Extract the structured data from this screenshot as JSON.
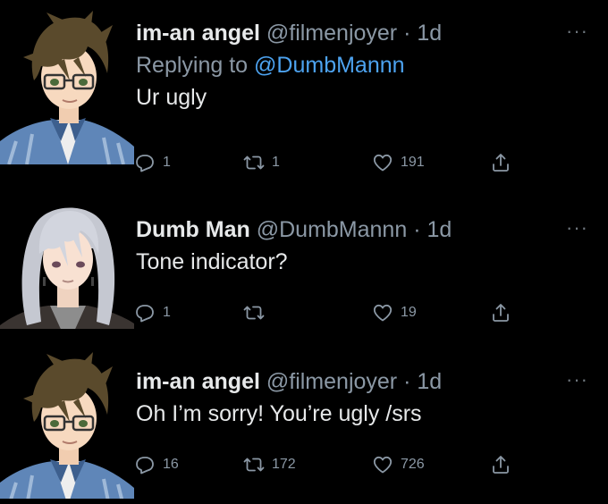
{
  "tweets": [
    {
      "name": "im-an angel",
      "handle": "@filmenjoyer",
      "dot": "·",
      "time": "1d",
      "replying_prefix": "Replying to",
      "replying_to": "@DumbMannn",
      "text": "Ur ugly",
      "replies": "1",
      "retweets": "1",
      "likes": "191",
      "more": "···"
    },
    {
      "name": "Dumb Man",
      "handle": "@DumbMannn",
      "dot": "·",
      "time": "1d",
      "text": "Tone indicator?",
      "replies": "1",
      "retweets": "",
      "likes": "19",
      "more": "···"
    },
    {
      "name": "im-an angel",
      "handle": "@filmenjoyer",
      "dot": "·",
      "time": "1d",
      "text": "Oh I’m sorry! You’re ugly /srs",
      "replies": "16",
      "retweets": "172",
      "likes": "726",
      "more": "···"
    }
  ],
  "colors": {
    "background": "#000000",
    "text_primary": "#e7e9ea",
    "text_secondary": "#8b98a5",
    "link": "#4da3f0"
  }
}
